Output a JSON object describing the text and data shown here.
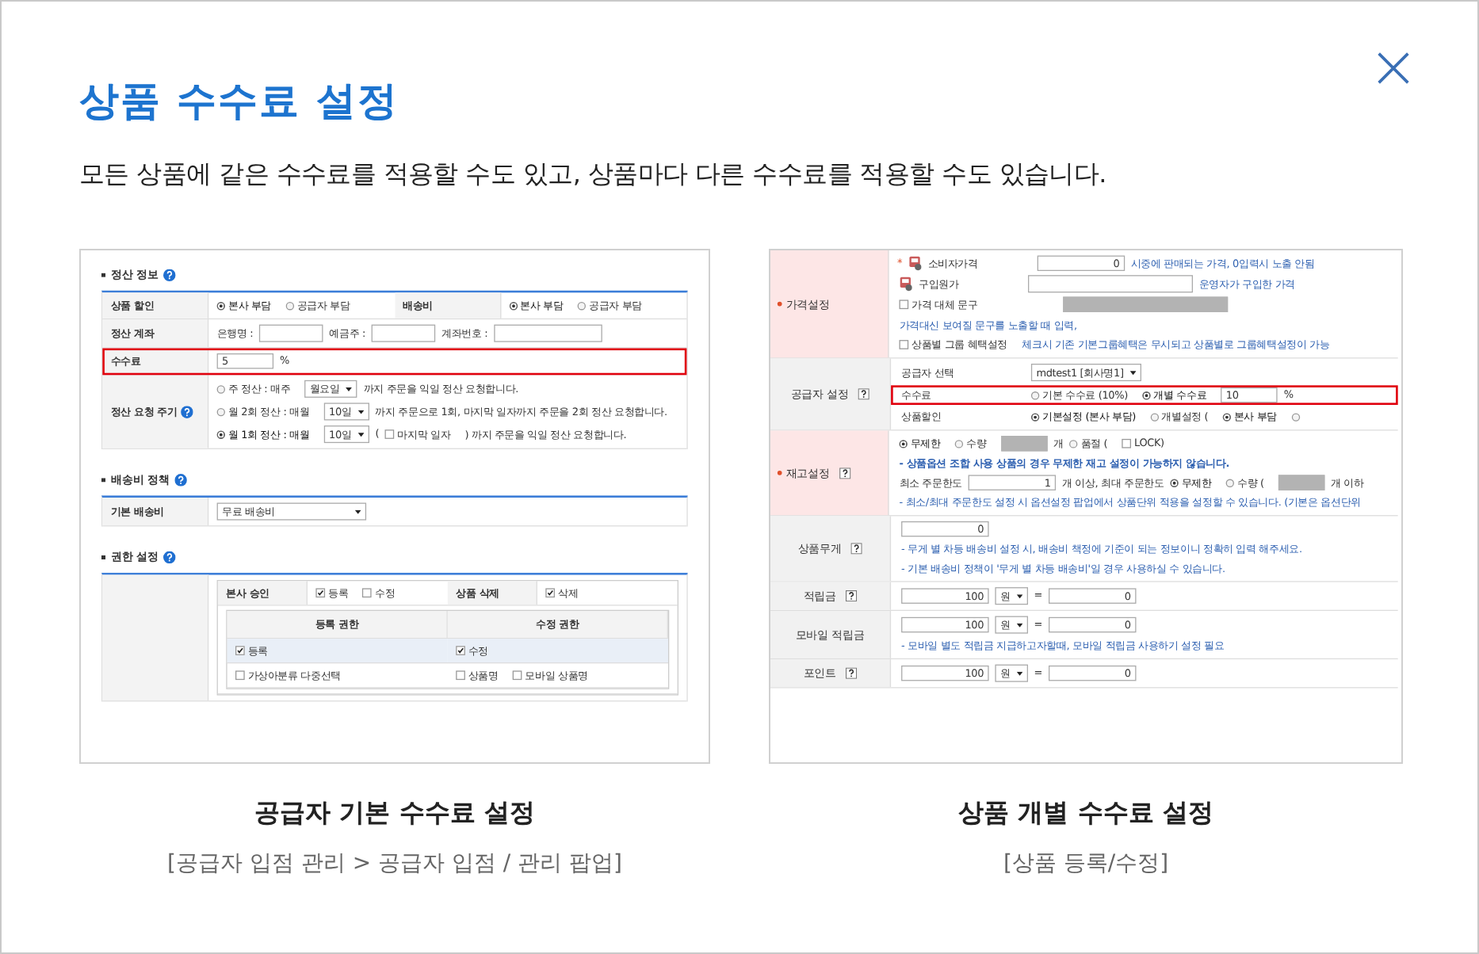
{
  "dialog": {
    "title": "상품 수수료 설정",
    "description": "모든 상품에 같은 수수료를 적용할 수도 있고, 상품마다 다른 수수료를 적용할 수도 있습니다."
  },
  "examples": [
    {
      "caption": "공급자 기본 수수료 설정",
      "path": "[공급자 입점 관리 > 공급자 입점 / 관리 팝업]",
      "screenshot": {
        "kind": "settlement",
        "sections": [
          {
            "title": "정산 정보",
            "help": true,
            "rows": [
              {
                "highlighted": false,
                "cells": [
                  {
                    "kind": "head",
                    "text": "상품 할인"
                  },
                  {
                    "kind": "body",
                    "lines": [
                      {
                        "highlighted": false,
                        "items": [
                          {
                            "kind": "radio",
                            "label": "본사 부담",
                            "selected": true
                          },
                          {
                            "kind": "radio",
                            "label": "공급자 부담",
                            "selected": false
                          }
                        ]
                      }
                    ]
                  },
                  {
                    "kind": "head",
                    "text": "배송비"
                  },
                  {
                    "kind": "body",
                    "lines": [
                      {
                        "highlighted": false,
                        "items": [
                          {
                            "kind": "radio",
                            "label": "본사 부담",
                            "selected": true
                          },
                          {
                            "kind": "radio",
                            "label": "공급자 부담",
                            "selected": false
                          }
                        ]
                      }
                    ]
                  }
                ]
              },
              {
                "highlighted": false,
                "cells": [
                  {
                    "kind": "head",
                    "text": "정산 계좌"
                  },
                  {
                    "kind": "body",
                    "lines": [
                      {
                        "highlighted": false,
                        "items": [
                          {
                            "kind": "text",
                            "text": "은행명 :"
                          },
                          {
                            "kind": "blank-input"
                          },
                          {
                            "kind": "text",
                            "text": "예금주 :"
                          },
                          {
                            "kind": "blank-input"
                          },
                          {
                            "kind": "text",
                            "text": "계좌번호 :"
                          },
                          {
                            "kind": "wide-blank-input"
                          }
                        ]
                      }
                    ]
                  }
                ]
              },
              {
                "highlighted": true,
                "cells": [
                  {
                    "kind": "head",
                    "text": "수수료"
                  },
                  {
                    "kind": "body",
                    "lines": [
                      {
                        "highlighted": false,
                        "items": [
                          {
                            "kind": "text-input",
                            "value": "5"
                          },
                          {
                            "kind": "text",
                            "text": "%"
                          }
                        ]
                      }
                    ]
                  }
                ]
              },
              {
                "highlighted": false,
                "cells": [
                  {
                    "kind": "head",
                    "text": "정산 요청 주기",
                    "help": true
                  },
                  {
                    "kind": "body",
                    "lines": [
                      {
                        "highlighted": false,
                        "items": [
                          {
                            "kind": "radio",
                            "label": "주 정산 : 매주",
                            "selected": false
                          },
                          {
                            "kind": "select",
                            "value": "월요일"
                          },
                          {
                            "kind": "text",
                            "text": "까지 주문을 익일 정산 요청합니다."
                          }
                        ]
                      },
                      {
                        "highlighted": false,
                        "items": [
                          {
                            "kind": "radio",
                            "label": "월 2회 정산 : 매월",
                            "selected": false
                          },
                          {
                            "kind": "select",
                            "value": "10일"
                          },
                          {
                            "kind": "text",
                            "text": "까지 주문으로 1회, 마지막 일자까지 주문을 2회 정산 요청합니다."
                          }
                        ]
                      },
                      {
                        "highlighted": false,
                        "items": [
                          {
                            "kind": "radio",
                            "label": "월 1회 정산 : 매월",
                            "selected": true
                          },
                          {
                            "kind": "select",
                            "value": "10일"
                          },
                          {
                            "kind": "text",
                            "text": "("
                          },
                          {
                            "kind": "check",
                            "label": "마지막 일자",
                            "checked": false
                          },
                          {
                            "kind": "text",
                            "text": ") 까지 주문을 익일 정산 요청합니다."
                          }
                        ]
                      }
                    ]
                  }
                ]
              }
            ]
          },
          {
            "title": "배송비 정책",
            "help": true,
            "rows": [
              {
                "highlighted": false,
                "cells": [
                  {
                    "kind": "head",
                    "text": "기본 배송비"
                  },
                  {
                    "kind": "body",
                    "lines": [
                      {
                        "highlighted": false,
                        "items": [
                          {
                            "kind": "wide-select",
                            "value": "무료 배송비"
                          }
                        ]
                      }
                    ]
                  }
                ]
              }
            ]
          },
          {
            "title": "권한 설정",
            "help": true,
            "rows": [
              {
                "highlighted": false,
                "cells": [
                  {
                    "kind": "head"
                  },
                  {
                    "kind": "body",
                    "table": {
                      "rows": [
                        {
                          "highlighted": false,
                          "cells": [
                            {
                              "kind": "head",
                              "text": "본사 승인"
                            },
                            {
                              "kind": "body",
                              "lines": [
                                {
                                  "highlighted": false,
                                  "items": [
                                    {
                                      "kind": "check",
                                      "label": "등록",
                                      "checked": true
                                    },
                                    {
                                      "kind": "check",
                                      "label": "수정",
                                      "checked": false
                                    }
                                  ]
                                }
                              ]
                            },
                            {
                              "kind": "head",
                              "text": "상품 삭제"
                            },
                            {
                              "kind": "body",
                              "lines": [
                                {
                                  "highlighted": false,
                                  "items": [
                                    {
                                      "kind": "check",
                                      "label": "삭제",
                                      "checked": true
                                    }
                                  ]
                                }
                              ]
                            }
                          ]
                        },
                        {
                          "highlighted": false,
                          "cells": [
                            {
                              "kind": "body",
                              "table": {
                                "rows": [
                                  {
                                    "highlighted": false,
                                    "cells": [
                                      {
                                        "kind": "colhead",
                                        "text": "등록 권한"
                                      },
                                      {
                                        "kind": "colhead",
                                        "text": "수정 권한"
                                      }
                                    ]
                                  },
                                  {
                                    "highlighted": false,
                                    "cells": [
                                      {
                                        "kind": "subhead",
                                        "lines": [
                                          {
                                            "highlighted": false,
                                            "items": [
                                              {
                                                "kind": "check",
                                                "label": "등록",
                                                "checked": true
                                              }
                                            ]
                                          }
                                        ]
                                      },
                                      {
                                        "kind": "subhead",
                                        "lines": [
                                          {
                                            "highlighted": false,
                                            "items": [
                                              {
                                                "kind": "check",
                                                "label": "수정",
                                                "checked": true
                                              }
                                            ]
                                          }
                                        ]
                                      }
                                    ]
                                  },
                                  {
                                    "highlighted": false,
                                    "cells": [
                                      {
                                        "kind": "body",
                                        "lines": [
                                          {
                                            "highlighted": false,
                                            "items": [
                                              {
                                                "kind": "check",
                                                "label": "가상아분류 다중선택",
                                                "checked": false
                                              }
                                            ]
                                          }
                                        ]
                                      },
                                      {
                                        "kind": "body",
                                        "lines": [
                                          {
                                            "highlighted": false,
                                            "items": [
                                              {
                                                "kind": "check",
                                                "label": "상품명",
                                                "checked": false
                                              },
                                              {
                                                "kind": "check",
                                                "label": "모바일 상품명",
                                                "checked": false
                                              }
                                            ]
                                          }
                                        ]
                                      }
                                    ]
                                  }
                                ]
                              }
                            }
                          ]
                        }
                      ]
                    }
                  }
                ]
              }
            ]
          }
        ]
      }
    },
    {
      "caption": "상품 개별 수수료 설정",
      "path": "[상품 등록/수정]",
      "screenshot": {
        "kind": "product",
        "sections": [
          {
            "rows": [
              {
                "highlighted": false,
                "cells": [
                  {
                    "kind": "head",
                    "text": "가격설정",
                    "required": true
                  },
                  {
                    "kind": "body",
                    "lines": [
                      {
                        "highlighted": false,
                        "items": [
                          {
                            "kind": "mark",
                            "text": "*"
                          },
                          {
                            "kind": "price-icon"
                          },
                          {
                            "kind": "field-label",
                            "text": "소비자가격"
                          },
                          {
                            "kind": "number-input",
                            "value": "0"
                          },
                          {
                            "kind": "note",
                            "text": "시중에 판매되는 가격, 0입력시 노출 안됨"
                          }
                        ]
                      },
                      {
                        "highlighted": false,
                        "items": [
                          {
                            "kind": "price-icon"
                          },
                          {
                            "kind": "field-label",
                            "text": "구입원가"
                          },
                          {
                            "kind": "wide-blank-input"
                          },
                          {
                            "kind": "note",
                            "text": "운영자가 구입한 가격"
                          }
                        ]
                      },
                      {
                        "highlighted": false,
                        "items": [
                          {
                            "kind": "field-check",
                            "label": "가격 대체 문구",
                            "checked": false
                          },
                          {
                            "kind": "wide-shaded-input"
                          },
                          {
                            "kind": "note",
                            "text": "가격대신 보여질 문구를 노출할 때 입력,"
                          }
                        ]
                      },
                      {
                        "highlighted": false,
                        "items": [
                          {
                            "kind": "check",
                            "label": "상품별 그룹 혜택설정",
                            "checked": false
                          },
                          {
                            "kind": "note",
                            "text": "체크시 기존 기본그룹혜택은 무시되고 상품별로 그룹혜택설정이 가능"
                          }
                        ]
                      }
                    ]
                  }
                ]
              },
              {
                "highlighted": false,
                "cells": [
                  {
                    "kind": "head",
                    "text": "공급자 설정",
                    "help": true,
                    "required": false
                  },
                  {
                    "kind": "body",
                    "lines": [
                      {
                        "highlighted": false,
                        "items": [
                          {
                            "kind": "field-label",
                            "text": "공급자 선택"
                          },
                          {
                            "kind": "select",
                            "value": "mdtest1 [회사명1]"
                          }
                        ]
                      },
                      {
                        "highlighted": true,
                        "items": [
                          {
                            "kind": "field-label",
                            "text": "수수료"
                          },
                          {
                            "kind": "radio",
                            "label": "기본 수수료 (10%)",
                            "selected": false
                          },
                          {
                            "kind": "radio",
                            "label": "개별 수수료",
                            "selected": true
                          },
                          {
                            "kind": "text-input",
                            "value": "10"
                          },
                          {
                            "kind": "text",
                            "text": "%"
                          }
                        ]
                      },
                      {
                        "highlighted": false,
                        "items": [
                          {
                            "kind": "field-label",
                            "text": "상품할인"
                          },
                          {
                            "kind": "radio",
                            "label": "기본설정 (본사 부담)",
                            "selected": true
                          },
                          {
                            "kind": "radio",
                            "label": "개별설정 (",
                            "selected": false
                          },
                          {
                            "kind": "radio",
                            "label": "본사 부담",
                            "selected": true
                          },
                          {
                            "kind": "radio",
                            "selected": false
                          }
                        ]
                      }
                    ]
                  }
                ]
              },
              {
                "highlighted": false,
                "cells": [
                  {
                    "kind": "head",
                    "text": "재고설정",
                    "help": true,
                    "required": true
                  },
                  {
                    "kind": "body",
                    "lines": [
                      {
                        "highlighted": false,
                        "items": [
                          {
                            "kind": "radio",
                            "label": "무제한",
                            "selected": true
                          },
                          {
                            "kind": "radio",
                            "label": "수량",
                            "selected": false
                          },
                          {
                            "kind": "shaded-input"
                          },
                          {
                            "kind": "text",
                            "text": "개"
                          },
                          {
                            "kind": "radio",
                            "label": "품절 (",
                            "selected": false
                          },
                          {
                            "kind": "check",
                            "label": "LOCK)",
                            "checked": false
                          }
                        ]
                      },
                      {
                        "highlighted": false,
                        "items": [
                          {
                            "kind": "bold-note",
                            "text": "- 상품옵션 조합 사용 상품의 경우 무제한 재고 설정이 가능하지 않습니다."
                          }
                        ]
                      },
                      {
                        "highlighted": false,
                        "items": [
                          {
                            "kind": "text",
                            "text": "최소 주문한도"
                          },
                          {
                            "kind": "number-input",
                            "value": "1"
                          },
                          {
                            "kind": "text",
                            "text": "개 이상, 최대 주문한도"
                          },
                          {
                            "kind": "radio",
                            "label": "무제한",
                            "selected": true
                          },
                          {
                            "kind": "radio",
                            "label": "수량 (",
                            "selected": false
                          },
                          {
                            "kind": "shaded-input"
                          },
                          {
                            "kind": "text",
                            "text": "개 이하"
                          }
                        ]
                      },
                      {
                        "highlighted": false,
                        "items": [
                          {
                            "kind": "note",
                            "text": "- 최소/최대 주문한도 설정 시 옵션설정 팝업에서 상품단위 적용을 설정할 수 있습니다. (기본은 옵션단위"
                          }
                        ]
                      }
                    ]
                  }
                ]
              },
              {
                "highlighted": false,
                "cells": [
                  {
                    "kind": "head",
                    "text": "상품무게",
                    "help": true,
                    "required": false
                  },
                  {
                    "kind": "body",
                    "lines": [
                      {
                        "highlighted": false,
                        "items": [
                          {
                            "kind": "number-input",
                            "value": "0"
                          }
                        ]
                      },
                      {
                        "highlighted": false,
                        "items": [
                          {
                            "kind": "note",
                            "text": "- 무게 별 차등 배송비 설정 시, 배송비 책정에 기준이 되는 정보이니 정확히 입력 해주세요."
                          }
                        ]
                      },
                      {
                        "highlighted": false,
                        "items": [
                          {
                            "kind": "note",
                            "text": "- 기본 배송비 정책이 '무게 별 차등 배송비'일 경우 사용하실 수 있습니다."
                          }
                        ]
                      }
                    ]
                  }
                ]
              },
              {
                "highlighted": false,
                "cells": [
                  {
                    "kind": "head",
                    "text": "적립금",
                    "help": true,
                    "required": false
                  },
                  {
                    "kind": "body",
                    "lines": [
                      {
                        "highlighted": false,
                        "items": [
                          {
                            "kind": "number-input",
                            "value": "100"
                          },
                          {
                            "kind": "select",
                            "value": "원"
                          },
                          {
                            "kind": "text",
                            "text": "="
                          },
                          {
                            "kind": "number-input",
                            "value": "0"
                          }
                        ]
                      }
                    ]
                  }
                ]
              },
              {
                "highlighted": false,
                "cells": [
                  {
                    "kind": "head",
                    "text": "모바일 적립금",
                    "required": false
                  },
                  {
                    "kind": "body",
                    "lines": [
                      {
                        "highlighted": false,
                        "items": [
                          {
                            "kind": "number-input",
                            "value": "100"
                          },
                          {
                            "kind": "select",
                            "value": "원"
                          },
                          {
                            "kind": "text",
                            "text": "="
                          },
                          {
                            "kind": "number-input",
                            "value": "0"
                          }
                        ]
                      },
                      {
                        "highlighted": false,
                        "items": [
                          {
                            "kind": "note",
                            "text": "- 모바일 별도 적립금 지급하고자할때, 모바일 적립금 사용하기 설정 필요"
                          }
                        ]
                      }
                    ]
                  }
                ]
              },
              {
                "highlighted": false,
                "cells": [
                  {
                    "kind": "head",
                    "text": "포인트",
                    "help": true,
                    "required": false
                  },
                  {
                    "kind": "body",
                    "lines": [
                      {
                        "highlighted": false,
                        "items": [
                          {
                            "kind": "number-input",
                            "value": "100"
                          },
                          {
                            "kind": "select",
                            "value": "원"
                          },
                          {
                            "kind": "text",
                            "text": "="
                          },
                          {
                            "kind": "number-input",
                            "value": "0"
                          }
                        ]
                      }
                    ]
                  }
                ]
              }
            ]
          }
        ]
      }
    }
  ]
}
